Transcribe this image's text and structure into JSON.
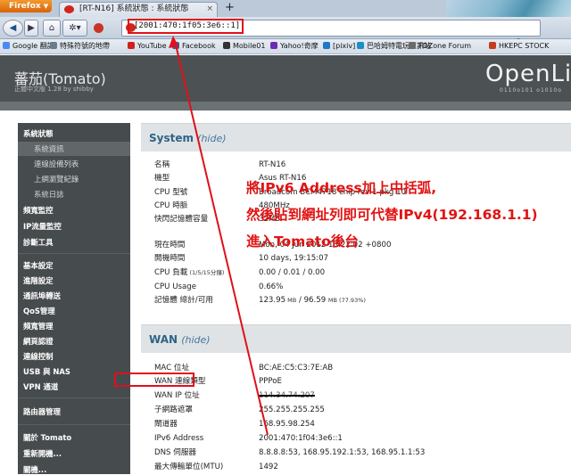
{
  "browser": {
    "menu_label": "Firefox",
    "tab_title": "[RT-N16] 系統狀態 : 系統狀態",
    "tab_close": "×",
    "new_tab": "+",
    "url": "[2001:470:1f05:3e6::1]",
    "search_engine": "f1",
    "bookmarks": [
      {
        "label": "Google 翻譯",
        "color": "#4a8af4"
      },
      {
        "label": "特殊符號的地帶",
        "color": "#6b7d8c"
      },
      {
        "label": "YouTube",
        "color": "#d21f1f"
      },
      {
        "label": "Facebook",
        "color": "#3b5998"
      },
      {
        "label": "Mobile01",
        "color": "#333333"
      },
      {
        "label": "Yahoo!奇摩",
        "color": "#6d2ab6"
      },
      {
        "label": "[pixiv]",
        "color": "#1f77c9"
      },
      {
        "label": "巴哈姆特電玩資訊站",
        "color": "#1b8fc6"
      },
      {
        "label": "FDZone Forum",
        "color": "#6a6a6a"
      },
      {
        "label": "HKEPC STOCK",
        "color": "#c43d1f"
      }
    ]
  },
  "header": {
    "brand": "蕃茄(Tomato)",
    "brand_sub": "正體中文版 1.28 by shibby",
    "logo": "OpenLi",
    "binary": "0110o101 o1010o"
  },
  "sidebar": {
    "items": [
      {
        "label": "系統狀態",
        "type": "main",
        "active": false
      },
      {
        "label": "系統資訊",
        "type": "sub",
        "active": true
      },
      {
        "label": "連線設備列表",
        "type": "sub",
        "active": false
      },
      {
        "label": "上網瀏覽紀錄",
        "type": "sub",
        "active": false
      },
      {
        "label": "系統日誌",
        "type": "sub",
        "active": false
      },
      {
        "label": "頻寬監控",
        "type": "main",
        "active": false
      },
      {
        "label": "IP流量監控",
        "type": "main",
        "active": false
      },
      {
        "label": "診斷工具",
        "type": "main",
        "active": false
      },
      {
        "label": "基本設定",
        "type": "main",
        "active": false
      },
      {
        "label": "進階設定",
        "type": "main",
        "active": false
      },
      {
        "label": "通訊埠轉送",
        "type": "main",
        "active": false
      },
      {
        "label": "QoS管理",
        "type": "main",
        "active": false
      },
      {
        "label": "頻寬管理",
        "type": "main",
        "active": false
      },
      {
        "label": "網頁認證",
        "type": "main",
        "active": false
      },
      {
        "label": "連線控制",
        "type": "main",
        "active": false
      },
      {
        "label": "USB 與 NAS",
        "type": "main",
        "active": false
      },
      {
        "label": "VPN 通道",
        "type": "main",
        "active": false
      },
      {
        "label": "路由器管理",
        "type": "main",
        "active": false
      },
      {
        "label": "關於 Tomato",
        "type": "main",
        "active": false
      },
      {
        "label": "重新開機...",
        "type": "main",
        "active": false
      },
      {
        "label": "關機...",
        "type": "main",
        "active": false
      }
    ]
  },
  "system": {
    "title": "System",
    "hide": "(hide)",
    "rows": [
      {
        "label": "名稱",
        "value": "RT-N16"
      },
      {
        "label": "機型",
        "value": "Asus RT-N16"
      },
      {
        "label": "CPU 型號",
        "value": "Broadcom BCM4718 chip rev 1 pkg 10"
      },
      {
        "label": "CPU 時脈",
        "value": "480MHz"
      },
      {
        "label": "快閃記憶體容量",
        "value": "32MB"
      },
      {
        "label": "現在時間",
        "value": "Mon, 04 Jun 2012 10:22:02 +0800"
      },
      {
        "label": "開機時間",
        "value": "10 days, 19:15:07"
      },
      {
        "label": "CPU 負載",
        "label_small": "(1/5/15分鐘)",
        "value": "0.00 / 0.01 / 0.00"
      },
      {
        "label": "CPU Usage",
        "value": "0.66%"
      },
      {
        "label": "記憶體 總計/可用",
        "value": "123.95",
        "value_unit1": "MB",
        "value_mid": " / 96.59 ",
        "value_unit2": "MB (77.93%)"
      }
    ]
  },
  "wan": {
    "title": "WAN",
    "hide": "(hide)",
    "rows": [
      {
        "label": "MAC 位址",
        "value": "BC:AE:C5:C3:7E:AB"
      },
      {
        "label": "WAN 連線類型",
        "value": "PPPoE"
      },
      {
        "label": "WAN IP 位址",
        "value": "114.34.74.207"
      },
      {
        "label": "子網路遮罩",
        "value": "255.255.255.255"
      },
      {
        "label": "閘道器",
        "value": "168.95.98.254"
      },
      {
        "label": "IPv6 Address",
        "value": "2001:470:1f04:3e6::1"
      },
      {
        "label": "DNS 伺服器",
        "value": "8.8.8.8:53, 168.95.192.1:53, 168.95.1.1:53"
      },
      {
        "label": "最大傳輸單位(MTU)",
        "value": "1492"
      }
    ]
  },
  "annotation": {
    "lines": [
      "將IPv6 Address加上中括弧,",
      "然後貼到網址列即可代替IPv4(192.168.1.1)",
      "進入Tomato後台"
    ],
    "color": "#e11313"
  }
}
